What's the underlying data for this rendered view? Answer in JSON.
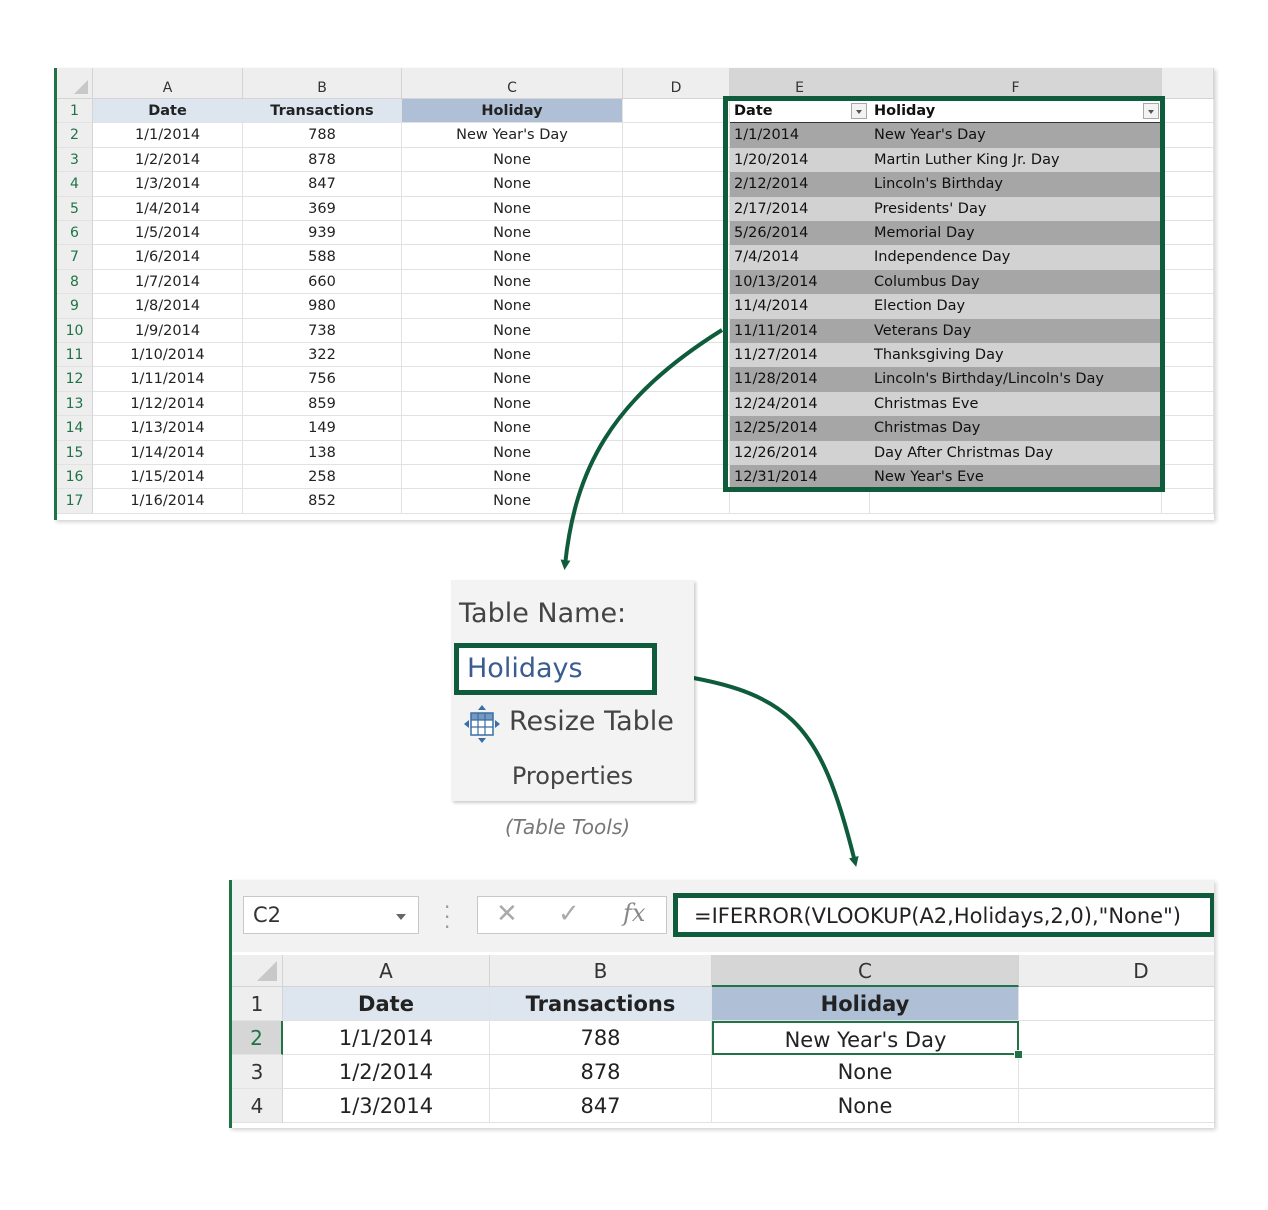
{
  "top_sheet": {
    "col_headers": [
      "A",
      "B",
      "C",
      "D",
      "E",
      "F"
    ],
    "row_numbers": [
      "1",
      "2",
      "3",
      "4",
      "5",
      "6",
      "7",
      "8",
      "9",
      "10",
      "11",
      "12",
      "13",
      "14",
      "15",
      "16",
      "17"
    ],
    "header_row": {
      "date": "Date",
      "transactions": "Transactions",
      "holiday": "Holiday"
    },
    "rows": [
      {
        "date": "1/1/2014",
        "transactions": "788",
        "holiday": "New Year's Day"
      },
      {
        "date": "1/2/2014",
        "transactions": "878",
        "holiday": "None"
      },
      {
        "date": "1/3/2014",
        "transactions": "847",
        "holiday": "None"
      },
      {
        "date": "1/4/2014",
        "transactions": "369",
        "holiday": "None"
      },
      {
        "date": "1/5/2014",
        "transactions": "939",
        "holiday": "None"
      },
      {
        "date": "1/6/2014",
        "transactions": "588",
        "holiday": "None"
      },
      {
        "date": "1/7/2014",
        "transactions": "660",
        "holiday": "None"
      },
      {
        "date": "1/8/2014",
        "transactions": "980",
        "holiday": "None"
      },
      {
        "date": "1/9/2014",
        "transactions": "738",
        "holiday": "None"
      },
      {
        "date": "1/10/2014",
        "transactions": "322",
        "holiday": "None"
      },
      {
        "date": "1/11/2014",
        "transactions": "756",
        "holiday": "None"
      },
      {
        "date": "1/12/2014",
        "transactions": "859",
        "holiday": "None"
      },
      {
        "date": "1/13/2014",
        "transactions": "149",
        "holiday": "None"
      },
      {
        "date": "1/14/2014",
        "transactions": "138",
        "holiday": "None"
      },
      {
        "date": "1/15/2014",
        "transactions": "258",
        "holiday": "None"
      },
      {
        "date": "1/16/2014",
        "transactions": "852",
        "holiday": "None"
      }
    ],
    "holiday_table": {
      "headers": {
        "date": "Date",
        "holiday": "Holiday"
      },
      "rows": [
        {
          "date": "1/1/2014",
          "holiday": "New Year's Day"
        },
        {
          "date": "1/20/2014",
          "holiday": "Martin Luther King Jr. Day"
        },
        {
          "date": "2/12/2014",
          "holiday": "Lincoln's Birthday"
        },
        {
          "date": "2/17/2014",
          "holiday": "Presidents' Day"
        },
        {
          "date": "5/26/2014",
          "holiday": "Memorial Day"
        },
        {
          "date": "7/4/2014",
          "holiday": "Independence Day"
        },
        {
          "date": "10/13/2014",
          "holiday": "Columbus Day"
        },
        {
          "date": "11/4/2014",
          "holiday": "Election Day"
        },
        {
          "date": "11/11/2014",
          "holiday": "Veterans Day"
        },
        {
          "date": "11/27/2014",
          "holiday": "Thanksgiving Day"
        },
        {
          "date": "11/28/2014",
          "holiday": "Lincoln's Birthday/Lincoln's Day"
        },
        {
          "date": "12/24/2014",
          "holiday": "Christmas Eve"
        },
        {
          "date": "12/25/2014",
          "holiday": "Christmas Day"
        },
        {
          "date": "12/26/2014",
          "holiday": "Day After Christmas Day"
        },
        {
          "date": "12/31/2014",
          "holiday": "New Year's Eve"
        }
      ]
    }
  },
  "table_tools": {
    "table_name_label": "Table Name:",
    "table_name_value": "Holidays",
    "resize_label": "Resize Table",
    "group_label": "Properties",
    "caption": "(Table Tools)"
  },
  "bottom_sheet": {
    "name_box": "C2",
    "formula": "=IFERROR(VLOOKUP(A2,Holidays,2,0),\"None\")",
    "col_headers": [
      "A",
      "B",
      "C",
      "D"
    ],
    "row_numbers": [
      "1",
      "2",
      "3",
      "4"
    ],
    "header_row": {
      "date": "Date",
      "transactions": "Transactions",
      "holiday": "Holiday"
    },
    "rows": [
      {
        "date": "1/1/2014",
        "transactions": "788",
        "holiday": "New Year's Day"
      },
      {
        "date": "1/2/2014",
        "transactions": "878",
        "holiday": "None"
      },
      {
        "date": "1/3/2014",
        "transactions": "847",
        "holiday": "None"
      }
    ]
  },
  "colors": {
    "accent_green": "#0e5c3c",
    "excel_green": "#1f7346",
    "header_blue": "#dde5ef",
    "selected_header_blue": "#aebfd6"
  },
  "icons": {
    "resize": "resize-table-icon",
    "cancel": "cancel-x-icon",
    "enter": "checkmark-icon",
    "function": "fx-icon"
  }
}
